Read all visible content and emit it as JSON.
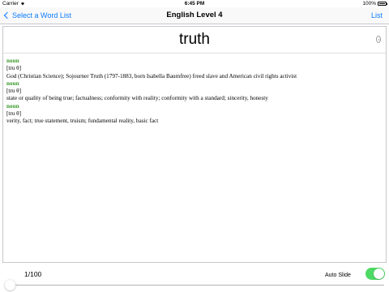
{
  "status_bar": {
    "carrier": "Carrier",
    "time": "6:45 PM",
    "battery": "100%"
  },
  "nav": {
    "back_label": "Select a Word List",
    "title": "English Level 4",
    "list_label": "List"
  },
  "card": {
    "word": "truth",
    "definitions": [
      {
        "pos": "noun",
        "pron": "[tru θ]",
        "meaning": "God (Christian Science); Sojourner Truth (1797-1883, born Isabella Baumfree) freed slave and American civil rights activist"
      },
      {
        "pos": "noun",
        "pron": "[tru θ]",
        "meaning": "state or quality of being true; factualness; conformity with reality; conformity with a standard; sincerity, honesty"
      },
      {
        "pos": "noun",
        "pron": "[tru θ]",
        "meaning": "verity, fact; true statement, truism; fundamental reality, basic fact"
      }
    ]
  },
  "footer": {
    "counter": "1/100",
    "auto_slide_label": "Auto Slide",
    "auto_slide_on": true,
    "progress_fraction": 0.01
  },
  "colors": {
    "accent": "#0a7aff",
    "pos_green": "#3a9a2a",
    "toggle_on": "#4cd964"
  },
  "icons": [
    "wifi-icon",
    "battery-icon",
    "back-chevron-icon",
    "speaker-icon"
  ]
}
